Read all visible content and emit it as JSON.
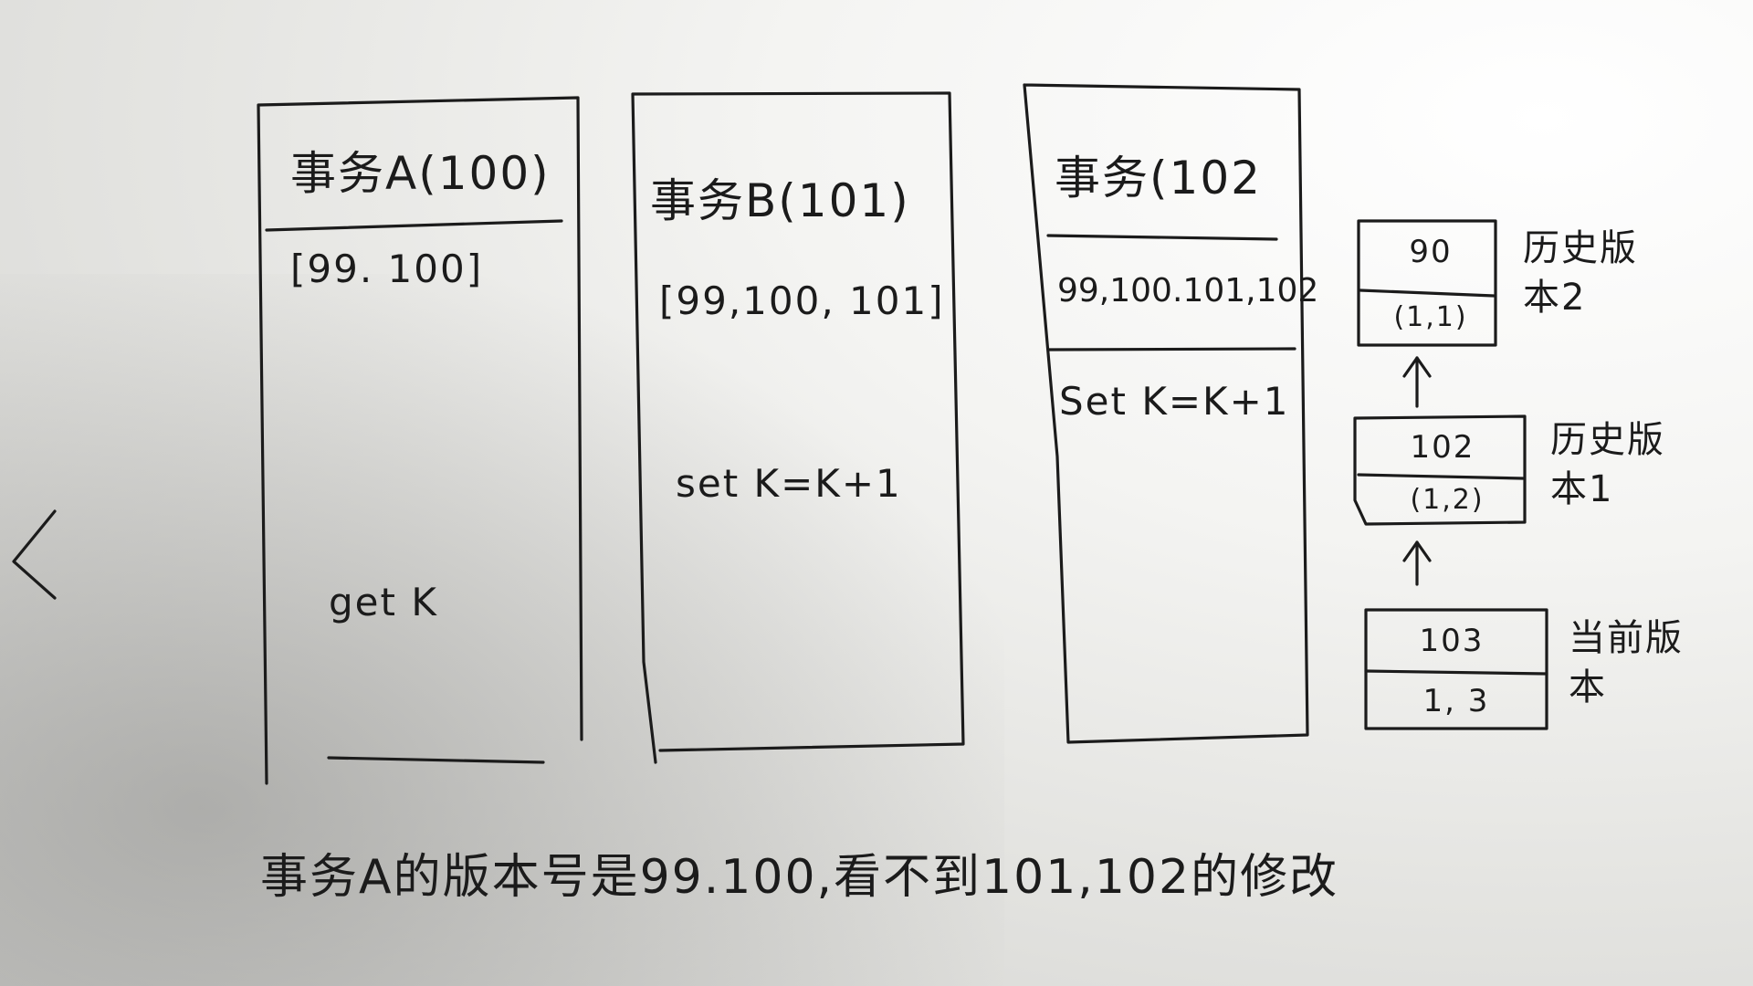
{
  "transactions": [
    {
      "title": "事务A(100)",
      "view": "[99. 100]",
      "op": "get K"
    },
    {
      "title": "事务B(101)",
      "view": "[99,100, 101]",
      "op": "set K=K+1"
    },
    {
      "title": "事务(102",
      "view": "99,100.101,102",
      "op": "Set K=K+1"
    }
  ],
  "versions": [
    {
      "txn": "90",
      "value": "(1,1)",
      "label": "历史版本2"
    },
    {
      "txn": "102",
      "value": "(1,2)",
      "label": "历史版本1"
    },
    {
      "txn": "103",
      "value": "1, 3",
      "label": "当前版本"
    }
  ],
  "caption": "事务A的版本号是99.100,看不到101,102的修改"
}
